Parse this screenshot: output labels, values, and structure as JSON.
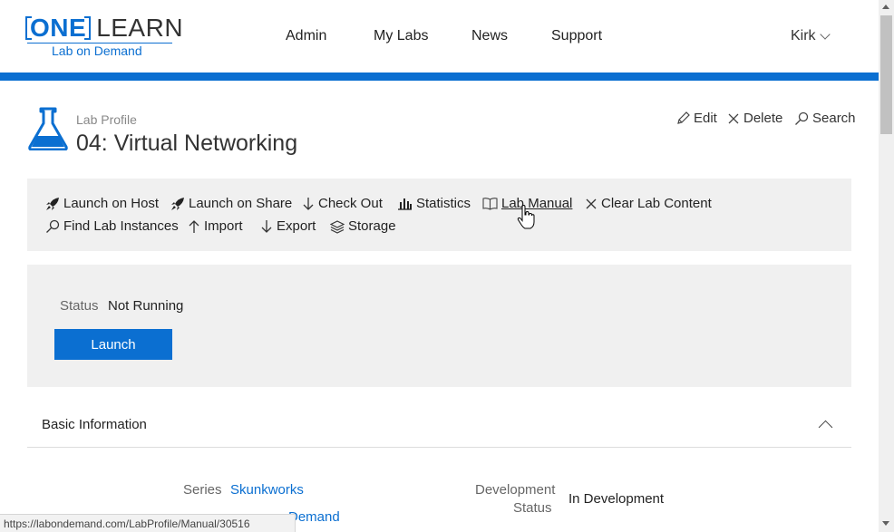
{
  "brand": {
    "one": "ONE",
    "learn": "LEARN",
    "sub": "Lab on Demand"
  },
  "nav": {
    "admin": "Admin",
    "my_labs": "My Labs",
    "news": "News",
    "support": "Support"
  },
  "user": {
    "name": "Kirk"
  },
  "page": {
    "breadcrumb": "Lab Profile",
    "title": "04: Virtual Networking"
  },
  "actions": {
    "edit": "Edit",
    "delete": "Delete",
    "search": "Search"
  },
  "toolbar": {
    "launch_on_host": "Launch on Host",
    "launch_on_share": "Launch on Share",
    "check_out": "Check Out",
    "statistics": "Statistics",
    "lab_manual": "Lab Manual",
    "clear_lab_content": "Clear Lab Content",
    "find_lab_instances": "Find Lab Instances",
    "import": "Import",
    "export": "Export",
    "storage": "Storage"
  },
  "status": {
    "label": "Status",
    "value": "Not Running",
    "launch": "Launch"
  },
  "basic_info": {
    "title": "Basic Information",
    "series_label": "Series",
    "series_value": "Skunkworks",
    "partial_link": "Demand",
    "dev_status_label_1": "Development",
    "dev_status_label_2": "Status",
    "dev_status_value": "In Development"
  },
  "status_bar": {
    "url": "https://labondemand.com/LabProfile/Manual/30516"
  },
  "colors": {
    "accent": "#0b6fd1",
    "panel": "#f0f0f0"
  }
}
